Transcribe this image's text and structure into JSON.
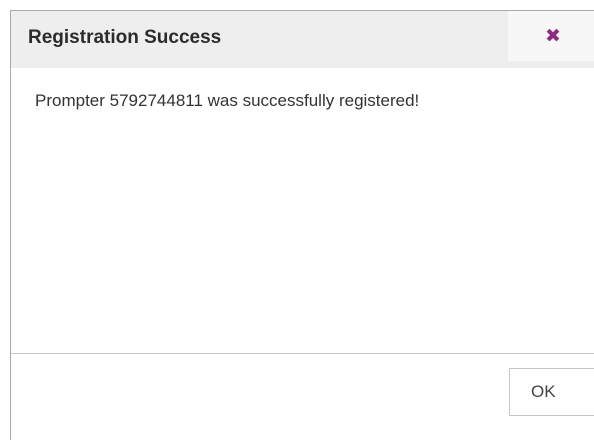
{
  "dialog": {
    "title": "Registration Success",
    "close_glyph": "✖",
    "close_icon": "close-icon",
    "message": "Prompter 5792744811 was successfully registered!",
    "ok_label": "OK"
  },
  "colors": {
    "titlebar_bg": "#eeeeee",
    "close_icon": "#8e2a84",
    "text": "#333333",
    "border": "#c8c8c8"
  }
}
